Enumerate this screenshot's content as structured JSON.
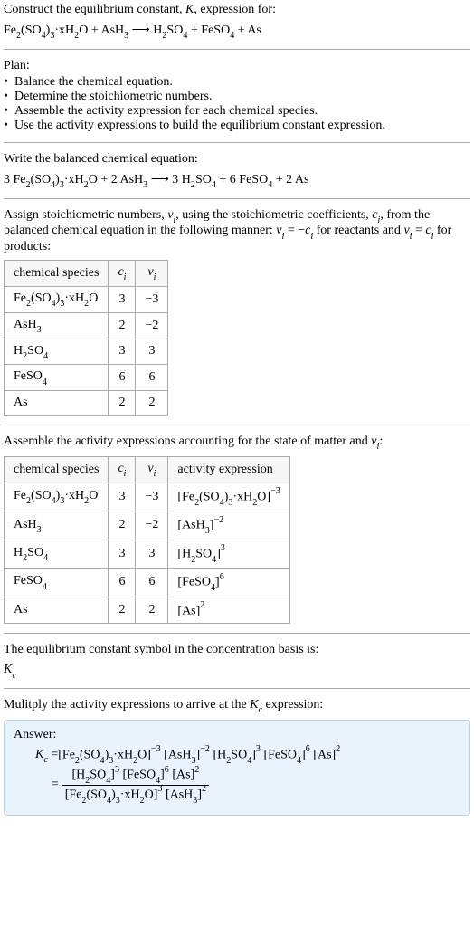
{
  "header": {
    "line1_pre": "Construct the equilibrium constant, ",
    "line1_K": "K",
    "line1_post": ", expression for:"
  },
  "topEq": {
    "r1": {
      "a": "Fe",
      "b": "2",
      "c": "(SO",
      "d": "4",
      "e": ")",
      "f": "3",
      "g": "·xH",
      "h": "2",
      "i": "O"
    },
    "plus1": " + ",
    "r2": {
      "a": "AsH",
      "b": "3"
    },
    "arrow": "  ⟶  ",
    "p1": {
      "a": "H",
      "b": "2",
      "c": "SO",
      "d": "4"
    },
    "plus2": " + ",
    "p2": {
      "a": "FeSO",
      "b": "4"
    },
    "plus3": " + ",
    "p3": "As"
  },
  "plan": {
    "title": "Plan:",
    "items": [
      "Balance the chemical equation.",
      "Determine the stoichiometric numbers.",
      "Assemble the activity expression for each chemical species.",
      "Use the activity expressions to build the equilibrium constant expression."
    ]
  },
  "balanced": {
    "label": "Write the balanced chemical equation:",
    "c_r1": "3 ",
    "c_r2": "2 ",
    "c_p1": "3 ",
    "c_p2": "6 ",
    "c_p3": "2 "
  },
  "assign": {
    "t1": "Assign stoichiometric numbers, ",
    "nu": "ν",
    "isub": "i",
    "t2": ", using the stoichiometric coefficients, ",
    "c": "c",
    "t3": ", from the balanced chemical equation in the following manner: ",
    "rel_r": " = −",
    "t4": " for reactants and ",
    "rel_p": " = ",
    "t5": " for products:"
  },
  "tbl1": {
    "h1": "chemical species",
    "h2c": "c",
    "h2s": "i",
    "h3c": "ν",
    "h3s": "i",
    "rows": [
      {
        "ci": "3",
        "nu": "−3"
      },
      {
        "ci": "2",
        "nu": "−2"
      },
      {
        "ci": "3",
        "nu": "3"
      },
      {
        "ci": "6",
        "nu": "6"
      },
      {
        "ci": "2",
        "nu": "2"
      }
    ]
  },
  "activityLabel": {
    "t1": "Assemble the activity expressions accounting for the state of matter and ",
    "t2": ":"
  },
  "tbl2": {
    "h4": "activity expression",
    "exps": [
      "−3",
      "−2",
      "3",
      "6",
      "2"
    ]
  },
  "eqconst": {
    "line1": "The equilibrium constant symbol in the concentration basis is:",
    "K": "K",
    "csub": "c"
  },
  "mulLabel": {
    "t1": "Mulitply the activity expressions to arrive at the ",
    "t2": " expression:"
  },
  "answer": {
    "label": "Answer:",
    "eqs": " = "
  }
}
